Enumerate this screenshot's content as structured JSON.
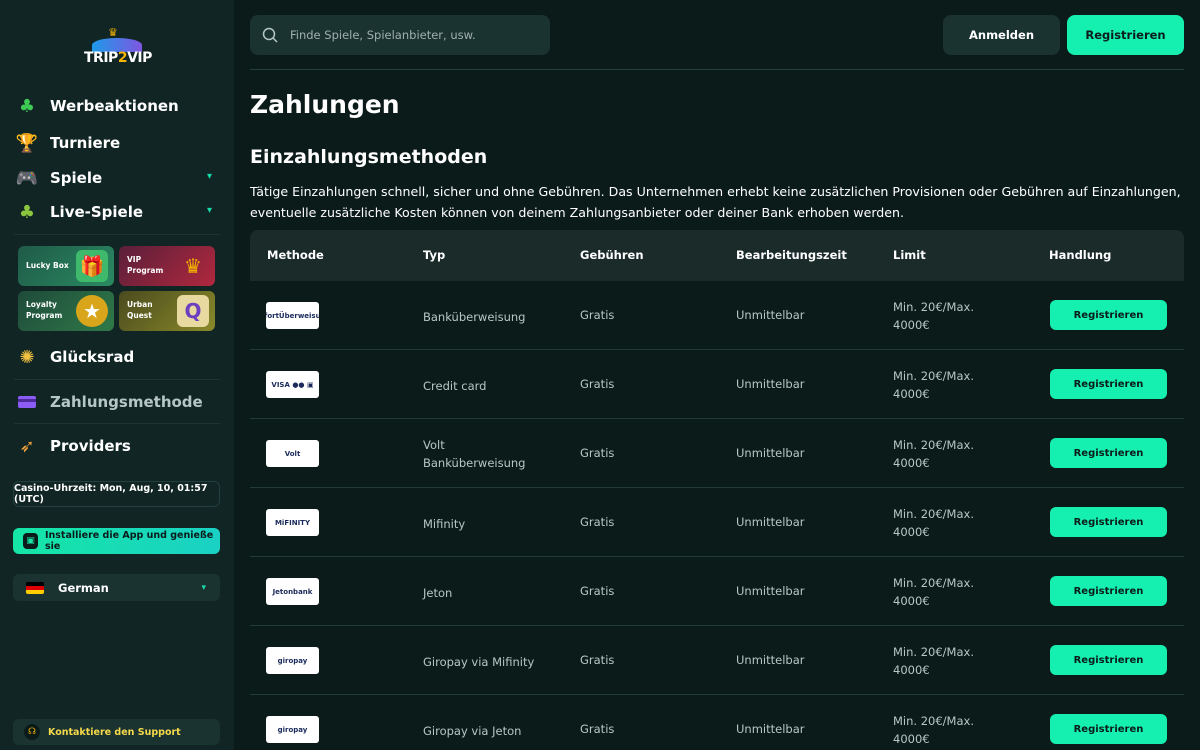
{
  "brand": {
    "logo_text_a": "TRIP",
    "logo_text_b": "2",
    "logo_text_c": "VIP"
  },
  "sidebar": {
    "nav": [
      {
        "label": "Werbeaktionen",
        "icon": "clover-icon"
      },
      {
        "label": "Turniere",
        "icon": "trophy-icon"
      },
      {
        "label": "Spiele",
        "icon": "gamepad-icon"
      },
      {
        "label": "Live-Spiele",
        "icon": "clover-icon"
      }
    ],
    "promos": [
      {
        "label": "Lucky Box",
        "icon": "gift-icon"
      },
      {
        "label": "VIP Program",
        "icon": "crown-icon"
      },
      {
        "label": "Loyalty Program",
        "icon": "medal-icon"
      },
      {
        "label": "Urban Quest",
        "icon": "scroll-icon"
      }
    ],
    "nav2": [
      {
        "label": "Glücksrad",
        "icon": "wheel-icon"
      },
      {
        "label": "Zahlungsmethode",
        "icon": "credit-card-icon"
      },
      {
        "label": "Providers",
        "icon": "rocket-icon"
      }
    ],
    "clock": "Casino-Uhrzeit: Mon, Aug, 10, 01:57 (UTC)",
    "install": "Installiere die App und genieße sie",
    "language": "German",
    "support": "Kontaktiere den Support"
  },
  "header": {
    "search_placeholder": "Finde Spiele, Spielanbieter, usw.",
    "login": "Anmelden",
    "register": "Registrieren"
  },
  "main": {
    "title": "Zahlungen",
    "subtitle": "Einzahlungsmethoden",
    "description": "Tätige Einzahlungen schnell, sicher und ohne Gebühren. Das Unternehmen erhebt keine zusätzlichen Provisionen oder Gebühren auf Einzahlungen, eventuelle zusätzliche Kosten können von deinem Zahlungsanbieter oder deiner Bank erhoben werden."
  },
  "table": {
    "headers": [
      "Methode",
      "Typ",
      "Gebühren",
      "Bearbeitungszeit",
      "Limit",
      "Handlung"
    ],
    "rows": [
      {
        "logo": "SofortÜberweisung",
        "type": "Banküberweisung",
        "fee": "Gratis",
        "time": "Unmittelbar",
        "limit_a": "Min. 20€/Max.",
        "limit_b": "4000€",
        "action": "Registrieren"
      },
      {
        "logo": "VISA ●● ▣",
        "type": "Credit card",
        "fee": "Gratis",
        "time": "Unmittelbar",
        "limit_a": "Min. 20€/Max.",
        "limit_b": "4000€",
        "action": "Registrieren"
      },
      {
        "logo": "Volt",
        "type": "Volt\nBanküberweisung",
        "fee": "Gratis",
        "time": "Unmittelbar",
        "limit_a": "Min. 20€/Max.",
        "limit_b": "4000€",
        "action": "Registrieren"
      },
      {
        "logo": "MiFINITY",
        "type": "Mifinity",
        "fee": "Gratis",
        "time": "Unmittelbar",
        "limit_a": "Min. 20€/Max.",
        "limit_b": "4000€",
        "action": "Registrieren"
      },
      {
        "logo": "Jetonbank",
        "type": "Jeton",
        "fee": "Gratis",
        "time": "Unmittelbar",
        "limit_a": "Min. 20€/Max.",
        "limit_b": "4000€",
        "action": "Registrieren"
      },
      {
        "logo": "giropay",
        "type": "Giropay via Mifinity",
        "fee": "Gratis",
        "time": "Unmittelbar",
        "limit_a": "Min. 20€/Max.",
        "limit_b": "4000€",
        "action": "Registrieren"
      },
      {
        "logo": "giropay",
        "type": "Giropay via Jeton",
        "fee": "Gratis",
        "time": "Unmittelbar",
        "limit_a": "Min. 20€/Max.",
        "limit_b": "4000€",
        "action": "Registrieren"
      }
    ]
  },
  "colors": {
    "accent": "#15f0b0",
    "bg": "#0b1b1a",
    "panel": "#102524",
    "muted": "#b7c7c5"
  }
}
